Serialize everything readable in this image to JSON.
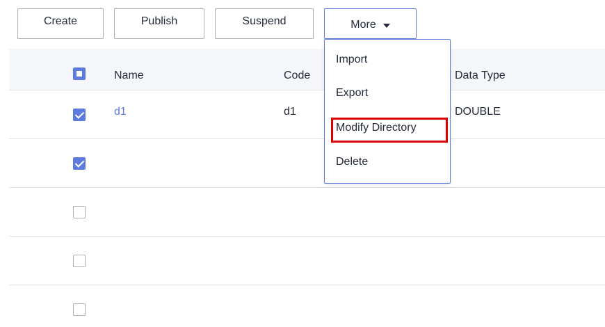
{
  "toolbar": {
    "create_label": "Create",
    "publish_label": "Publish",
    "suspend_label": "Suspend",
    "more_label": "More"
  },
  "table": {
    "columns": [
      "Name",
      "Code",
      "Data Type"
    ],
    "select_all_state": "partial",
    "rows": [
      {
        "checked": true,
        "name": "d1",
        "code": "d1",
        "data_type": "DOUBLE"
      },
      {
        "checked": true,
        "name": "",
        "code": "",
        "data_type": ""
      },
      {
        "checked": false,
        "name": "",
        "code": "",
        "data_type": ""
      },
      {
        "checked": false,
        "name": "",
        "code": "",
        "data_type": ""
      },
      {
        "checked": false,
        "name": "",
        "code": "",
        "data_type": ""
      }
    ]
  },
  "more_menu": {
    "items": [
      "Import",
      "Export",
      "Modify Directory",
      "Delete"
    ],
    "highlighted_item": "Modify Directory"
  },
  "colors": {
    "accent": "#5e7ce0",
    "highlight": "#e00000",
    "header_bg": "#f5f6fa"
  }
}
